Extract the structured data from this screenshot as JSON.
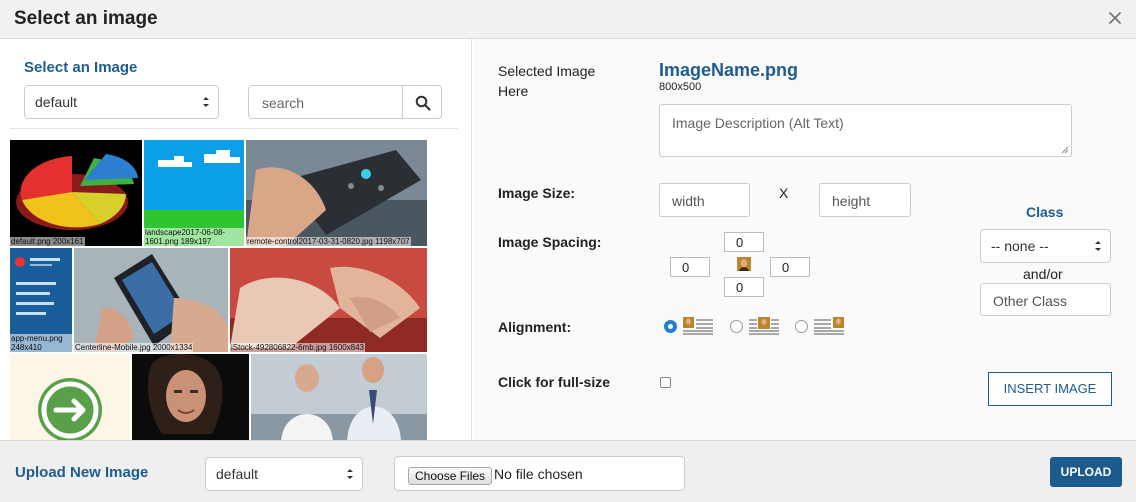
{
  "dialog": {
    "title": "Select an image"
  },
  "library": {
    "heading": "Select an Image",
    "folder_value": "default",
    "search_placeholder": "search",
    "thumbnails": [
      {
        "caption": "default.png 200x161"
      },
      {
        "caption": "landscape2017-06-08-1601.png 189x197"
      },
      {
        "caption": "remote-control2017-03-31-0820.jpg 1198x707"
      },
      {
        "caption": "app-menu.png 248x410"
      },
      {
        "caption": "Centerline-Mobile.jpg 2000x1334"
      },
      {
        "caption": "iStock-492806822-6mb.jpg 1600x843"
      },
      {
        "caption": ""
      },
      {
        "caption": ""
      },
      {
        "caption": ""
      }
    ]
  },
  "details": {
    "selected_label": "Selected Image Here",
    "image_name": "ImageName.png",
    "image_dims": "800x500",
    "alt_placeholder": "Image Description (Alt Text)",
    "size_label": "Image Size:",
    "width_placeholder": "width",
    "size_separator": "X",
    "height_placeholder": "height",
    "spacing_label": "Image Spacing:",
    "spacing": {
      "top": "0",
      "left": "0",
      "right": "0",
      "bottom": "0"
    },
    "alignment_label": "Alignment:",
    "alignment_selected": 0,
    "fullsize_label": "Click for full-size",
    "class_heading": "Class",
    "class_value": "-- none --",
    "andor": "and/or",
    "other_class_placeholder": "Other Class",
    "insert_label": "INSERT IMAGE"
  },
  "upload": {
    "heading": "Upload New Image",
    "folder_value": "default",
    "choose_label": "Choose Files",
    "no_file": "No file chosen",
    "button_label": "UPLOAD"
  },
  "colors": {
    "heading_blue": "#1f5c8f",
    "button_blue": "#1c5a8c",
    "radio_blue": "#1f7fd6"
  }
}
